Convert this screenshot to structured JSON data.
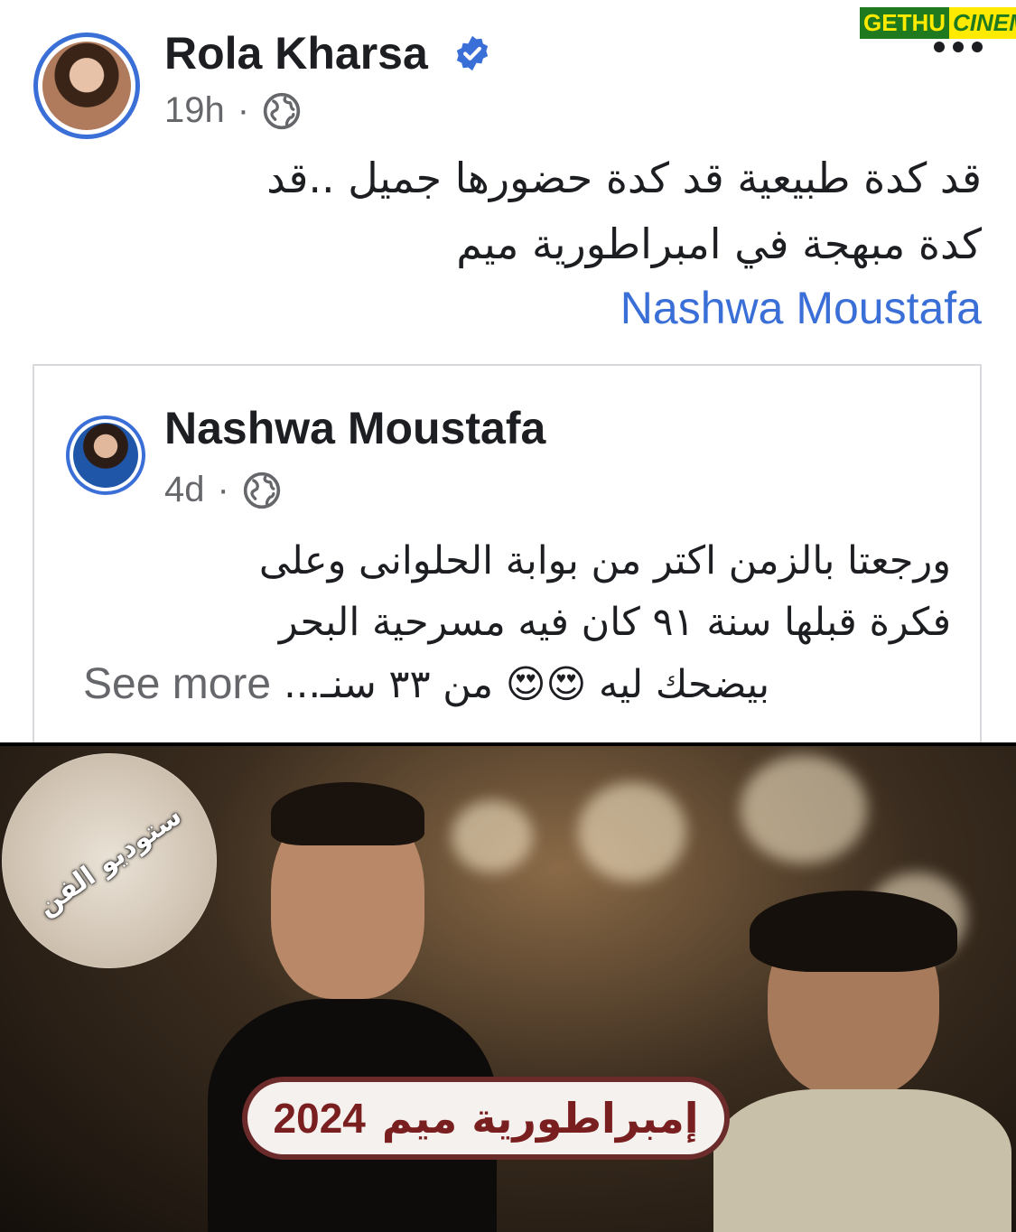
{
  "watermark": {
    "part1": "GETHU",
    "part2": "CINEMA"
  },
  "post": {
    "author": "Rola Kharsa",
    "time": "19h",
    "separator": "·",
    "text_line1": "قد كدة طبيعية  قد كدة  حضورها جميل ..قد",
    "text_line2": "كدة مبهجة في امبراطورية ميم",
    "mention": "Nashwa Moustafa"
  },
  "shared": {
    "author": "Nashwa Moustafa",
    "time": "4d",
    "separator": "·",
    "text_line1": "ورجعتا بالزمن اكتر   من بوابة الحلوانى وعلى",
    "text_line2": "فكرة قبلها سنة ٩١  كان فيه مسرحية البحر",
    "text_line3": "بيضحك ليه 😍😍  من ٣٣ سنـ...",
    "see_more": "See more"
  },
  "image": {
    "corner_badge_text": "ستوديو الفن",
    "caption_title": "إمبراطورية ميم",
    "caption_year": "2024"
  },
  "colors": {
    "accent": "#3b6fd8",
    "text": "#1c1e21",
    "muted": "#65676b",
    "caption": "#7a1f1f"
  },
  "icons": [
    "verified-badge-icon",
    "more-options-icon",
    "globe-icon"
  ]
}
